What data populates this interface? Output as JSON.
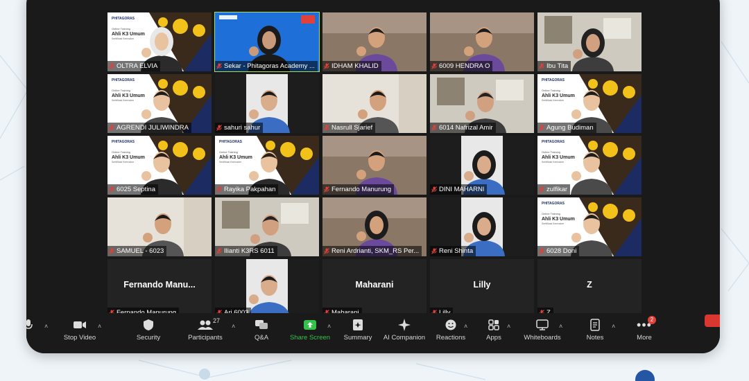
{
  "participants": [
    {
      "name": "OLTRA ELVIA",
      "type": "banner",
      "scene": "woman-hijab-white"
    },
    {
      "name": "Sekar - Phitagoras Academy ...",
      "type": "presenter",
      "active": true
    },
    {
      "name": "IDHAM KHALID",
      "type": "room"
    },
    {
      "name": "6009 HENDRA O",
      "type": "room"
    },
    {
      "name": "Ibu Tita",
      "type": "office"
    },
    {
      "name": "AGRENDI JULIWINDRA",
      "type": "banner",
      "scene": "man"
    },
    {
      "name": "sahuri sahur",
      "type": "dark-window"
    },
    {
      "name": "Nasrull Sjarief",
      "type": "bright"
    },
    {
      "name": "6014 Nafrizal Amir",
      "type": "office"
    },
    {
      "name": "Agung Budiman",
      "type": "banner",
      "scene": "man"
    },
    {
      "name": "6025 Septina",
      "type": "banner",
      "scene": "woman"
    },
    {
      "name": "Rayika Pakpahan",
      "type": "banner",
      "scene": "woman"
    },
    {
      "name": "Fernando Manurung",
      "type": "room"
    },
    {
      "name": "DINI MAHARNI",
      "type": "dark-window"
    },
    {
      "name": "zulfikar",
      "type": "banner",
      "scene": "man"
    },
    {
      "name": "SAMUEL - 6023",
      "type": "bright"
    },
    {
      "name": "Ilianti K3RS 6011",
      "type": "office"
    },
    {
      "name": "Reni Ardrianti, SKM_RS Per...",
      "type": "room"
    },
    {
      "name": "Reni Shinta",
      "type": "dark-window"
    },
    {
      "name": "6028 Doni",
      "type": "banner",
      "scene": "man"
    },
    {
      "name": "Fernando Manurung",
      "type": "text",
      "display": "Fernando  Manu..."
    },
    {
      "name": "Ari 6003",
      "type": "dark-window"
    },
    {
      "name": "Maharani",
      "type": "text",
      "display": "Maharani"
    },
    {
      "name": "Lilly",
      "type": "text",
      "display": "Lilly"
    },
    {
      "name": "Z",
      "type": "text",
      "display": "Z"
    }
  ],
  "banner": {
    "logo": "PHITAGORAS",
    "line1": "Online Training",
    "line2": "Ahli K3 Umum",
    "line3": "Sertifikasi Kemnaker"
  },
  "toolbar": {
    "stop_video": "Stop Video",
    "security": "Security",
    "participants": "Participants",
    "participants_count": "27",
    "qa": "Q&A",
    "share_screen": "Share Screen",
    "summary": "Summary",
    "ai_companion": "AI Companion",
    "reactions": "Reactions",
    "apps": "Apps",
    "whiteboards": "Whiteboards",
    "notes": "Notes",
    "more": "More",
    "more_badge": "2"
  },
  "colors": {
    "active_border": "#a6e05a",
    "share_green": "#33c24a",
    "muted_red": "#e0413b",
    "banner_navy": "#1c2c63",
    "helmet_yellow": "#f2c21b"
  }
}
